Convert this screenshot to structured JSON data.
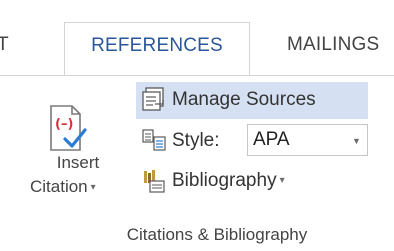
{
  "tabs": [
    {
      "label": "T"
    },
    {
      "label": "REFERENCES"
    },
    {
      "label": "MAILINGS"
    }
  ],
  "accent_color": "#2b579a",
  "hover_color": "#d5e1f2",
  "insert_citation": {
    "line1": "Insert",
    "line2": "Citation",
    "caret": "▾",
    "icon": "insert-citation-icon"
  },
  "manage_sources": {
    "label": "Manage Sources",
    "icon": "manage-sources-icon"
  },
  "style": {
    "label": "Style:",
    "value": "APA",
    "caret": "▼",
    "icon": "style-icon"
  },
  "bibliography": {
    "label": "Bibliography",
    "caret": "▾",
    "icon": "bibliography-icon"
  },
  "group": {
    "label": "Citations & Bibliography"
  }
}
